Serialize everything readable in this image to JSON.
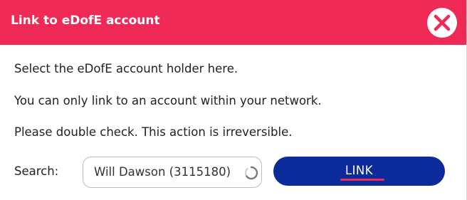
{
  "modal": {
    "title": "Link to eDofE account",
    "close_icon": "close-x-circle-icon"
  },
  "content": {
    "line1": "Select the eDofE account holder here.",
    "line2": "You can only link to an account within your network.",
    "line3": "Please double check. This action is irreversible."
  },
  "search": {
    "label": "Search:",
    "value": "Will Dawson (3115180)",
    "loading_icon": "spinner-icon"
  },
  "actions": {
    "link_label": "LINK"
  },
  "colors": {
    "header_bg": "#ef2a56",
    "accent_red": "#ef2a56",
    "primary_blue": "#0c2b9a",
    "white": "#ffffff"
  }
}
